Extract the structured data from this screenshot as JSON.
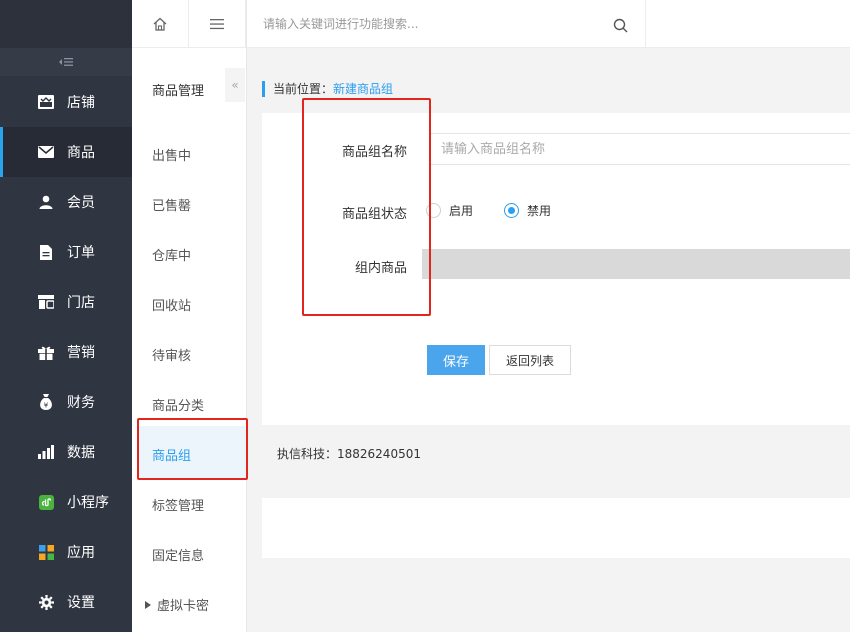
{
  "sidebar": {
    "items": [
      {
        "label": "店铺",
        "icon": "store-icon"
      },
      {
        "label": "商品",
        "icon": "mail-icon",
        "active": true
      },
      {
        "label": "会员",
        "icon": "user-icon"
      },
      {
        "label": "订单",
        "icon": "document-icon"
      },
      {
        "label": "门店",
        "icon": "shop-icon"
      },
      {
        "label": "营销",
        "icon": "gift-icon"
      },
      {
        "label": "财务",
        "icon": "money-bag-icon"
      },
      {
        "label": "数据",
        "icon": "bar-chart-icon"
      },
      {
        "label": "小程序",
        "icon": "mini-program-icon"
      },
      {
        "label": "应用",
        "icon": "apps-icon"
      },
      {
        "label": "设置",
        "icon": "gear-icon"
      }
    ]
  },
  "subnav": {
    "title": "商品管理",
    "fold_icon": "«",
    "items": [
      {
        "label": "出售中"
      },
      {
        "label": "已售罄"
      },
      {
        "label": "仓库中"
      },
      {
        "label": "回收站"
      },
      {
        "label": "待审核"
      },
      {
        "label": "商品分类"
      },
      {
        "label": "商品组",
        "active": true
      },
      {
        "label": "标签管理"
      },
      {
        "label": "固定信息"
      },
      {
        "label": "虚拟卡密"
      }
    ]
  },
  "topbar": {
    "search_placeholder": "请输入关键词进行功能搜索..."
  },
  "breadcrumb": {
    "prefix": "当前位置：",
    "current": "新建商品组"
  },
  "form": {
    "name_label": "商品组名称",
    "name_placeholder": "请输入商品组名称",
    "status_label": "商品组状态",
    "status_options": [
      {
        "label": "启用",
        "selected": false
      },
      {
        "label": "禁用",
        "selected": true
      }
    ],
    "goods_label": "组内商品",
    "save_label": "保存",
    "back_label": "返回列表"
  },
  "footer": {
    "text": "执信科技：18826240501"
  },
  "colors": {
    "accent": "#2a9ef0",
    "sidebar_bg": "#2f3541",
    "annotation_red": "#e3261d"
  }
}
